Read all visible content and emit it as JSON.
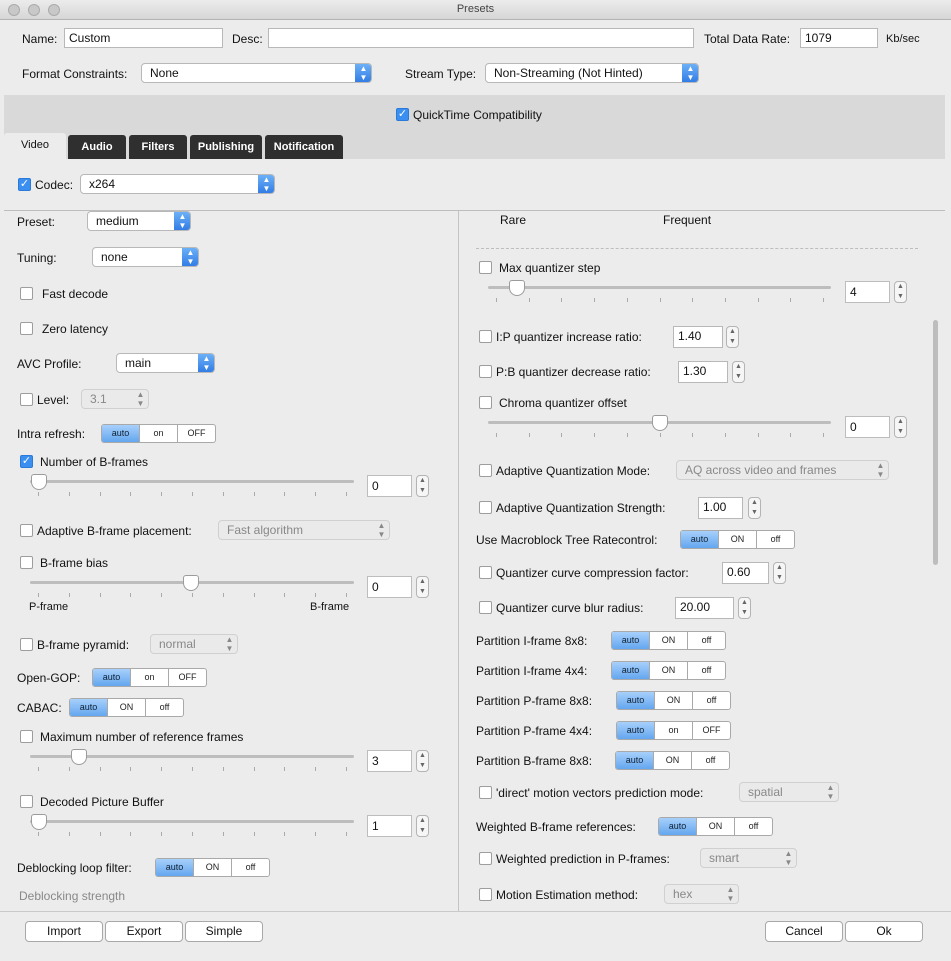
{
  "window": {
    "title": "Presets"
  },
  "top": {
    "name_label": "Name:",
    "name_value": "Custom",
    "desc_label": "Desc:",
    "desc_value": "",
    "rate_label": "Total Data Rate:",
    "rate_value": "1079",
    "rate_unit": "Kb/sec",
    "format_label": "Format Constraints:",
    "format_value": "None",
    "stream_label": "Stream Type:",
    "stream_value": "Non-Streaming (Not Hinted)",
    "qt_label": "QuickTime Compatibility"
  },
  "tabs": [
    "Video",
    "Audio",
    "Filters",
    "Publishing",
    "Notification"
  ],
  "codec": {
    "label": "Codec:",
    "value": "x264"
  },
  "left": {
    "preset_label": "Preset:",
    "preset_value": "medium",
    "tuning_label": "Tuning:",
    "tuning_value": "none",
    "fast_decode": "Fast decode",
    "zero_latency": "Zero latency",
    "avc_label": "AVC Profile:",
    "avc_value": "main",
    "level_label": "Level:",
    "level_value": "3.1",
    "intra_label": "Intra refresh:",
    "bframes_label": "Number of B-frames",
    "bframes_value": "0",
    "adaptive_label": "Adaptive B-frame placement:",
    "adaptive_value": "Fast algorithm",
    "bias_label": "B-frame bias",
    "bias_value": "0",
    "bias_left": "P-frame",
    "bias_right": "B-frame",
    "pyramid_label": "B-frame pyramid:",
    "pyramid_value": "normal",
    "opengop_label": "Open-GOP:",
    "cabac_label": "CABAC:",
    "maxref_label": "Maximum number of reference frames",
    "maxref_value": "3",
    "dpb_label": "Decoded Picture Buffer",
    "dpb_value": "1",
    "deblock_label": "Deblocking loop filter:",
    "deblock_strength": "Deblocking strength"
  },
  "right": {
    "rare": "Rare",
    "frequent": "Frequent",
    "maxq_label": "Max quantizer step",
    "maxq_value": "4",
    "ip_label": "I:P quantizer increase ratio:",
    "ip_value": "1.40",
    "pb_label": "P:B quantizer decrease ratio:",
    "pb_value": "1.30",
    "chroma_label": "Chroma quantizer offset",
    "chroma_value": "0",
    "aqmode_label": "Adaptive Quantization Mode:",
    "aqmode_value": "AQ across video and frames",
    "aqstr_label": "Adaptive Quantization Strength:",
    "aqstr_value": "1.00",
    "mbtree_label": "Use Macroblock Tree Ratecontrol:",
    "qcomp_label": "Quantizer curve compression factor:",
    "qcomp_value": "0.60",
    "qblur_label": "Quantizer curve blur radius:",
    "qblur_value": "20.00",
    "pi8_label": "Partition I-frame 8x8:",
    "pi4_label": "Partition I-frame 4x4:",
    "pp8_label": "Partition P-frame 8x8:",
    "pp4_label": "Partition P-frame 4x4:",
    "pb8_label": "Partition B-frame 8x8:",
    "direct_label": "'direct' motion vectors prediction mode:",
    "direct_value": "spatial",
    "wb_label": "Weighted B-frame references:",
    "wp_label": "Weighted prediction in P-frames:",
    "wp_value": "smart",
    "me_label": "Motion Estimation method:",
    "me_value": "hex"
  },
  "seg": {
    "auto": "auto",
    "on_lower": "on",
    "on_upper": "ON",
    "off_lower": "off",
    "off_upper": "OFF"
  },
  "buttons": {
    "import": "Import",
    "export": "Export",
    "simple": "Simple",
    "cancel": "Cancel",
    "ok": "Ok"
  }
}
